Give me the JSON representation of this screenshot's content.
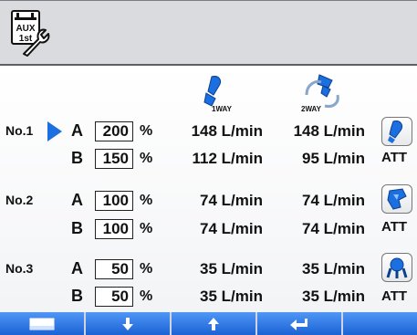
{
  "header": {
    "aux_icon": {
      "name": "aux-setting-wrench-icon",
      "line1": "AUX",
      "line2": "1st"
    }
  },
  "columns": {
    "one_way_label": "1WAY",
    "two_way_label": "2WAY"
  },
  "rows": [
    {
      "no": "No.1",
      "selected": true,
      "att_icon": "att-attachment-1-icon",
      "att_label": "ATT",
      "a": {
        "label": "A",
        "value": "200",
        "unit": "%",
        "oneway": "148 L/min",
        "twoway": "148 L/min"
      },
      "b": {
        "label": "B",
        "value": "150",
        "unit": "%",
        "oneway": "112 L/min",
        "twoway": "95 L/min"
      }
    },
    {
      "no": "No.2",
      "selected": false,
      "att_icon": "att-attachment-2-icon",
      "att_label": "ATT",
      "a": {
        "label": "A",
        "value": "100",
        "unit": "%",
        "oneway": "74 L/min",
        "twoway": "74 L/min"
      },
      "b": {
        "label": "B",
        "value": "100",
        "unit": "%",
        "oneway": "74 L/min",
        "twoway": "74 L/min"
      }
    },
    {
      "no": "No.3",
      "selected": false,
      "att_icon": "att-attachment-3-icon",
      "att_label": "ATT",
      "a": {
        "label": "A",
        "value": "50",
        "unit": "%",
        "oneway": "35 L/min",
        "twoway": "35 L/min"
      },
      "b": {
        "label": "B",
        "value": "50",
        "unit": "%",
        "oneway": "35 L/min",
        "twoway": "35 L/min"
      }
    }
  ],
  "function_keys": [
    {
      "icon": "screen-icon"
    },
    {
      "icon": "arrow-down-icon"
    },
    {
      "icon": "arrow-up-icon"
    },
    {
      "icon": "enter-return-icon"
    },
    {
      "icon": ""
    }
  ],
  "colors": {
    "accent": "#1c6fe0",
    "button": "#2f7de8",
    "header_bg": "#d9dbde"
  }
}
